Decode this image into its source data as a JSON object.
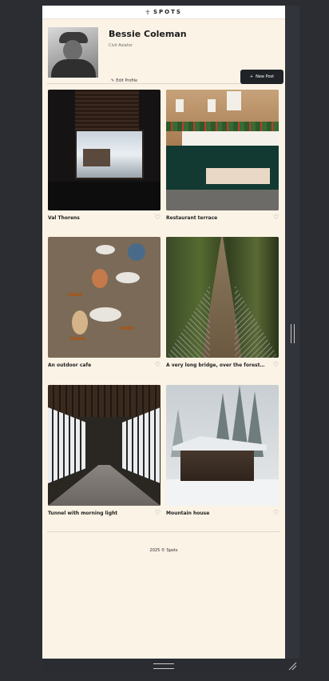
{
  "app": {
    "logo_text": "SPOTS",
    "logo_mark": "☥"
  },
  "profile": {
    "name": "Bessie Coleman",
    "role": "Civil Aviator",
    "edit_label": "Edit Profile",
    "new_post_label": "New Post"
  },
  "cards": [
    {
      "title": "Val Thorens",
      "image": "window-snow-chalet"
    },
    {
      "title": "Restaurant terrace",
      "image": "restaurant-terrace"
    },
    {
      "title": "An outdoor cafe",
      "image": "outdoor-cafe"
    },
    {
      "title": "A very long bridge, over the forest in t...",
      "image": "long-bridge-forest"
    },
    {
      "title": "Tunnel with morning light",
      "image": "tunnel-light"
    },
    {
      "title": "Mountain house",
      "image": "mountain-house"
    }
  ],
  "footer": {
    "text": "2025 © Spots"
  },
  "icons": {
    "edit": "pencil-icon",
    "add": "plus-icon",
    "like": "heart-icon"
  },
  "colors": {
    "background": "#fbf3e6",
    "button": "#1f2226",
    "frame": "#2b2d33"
  }
}
